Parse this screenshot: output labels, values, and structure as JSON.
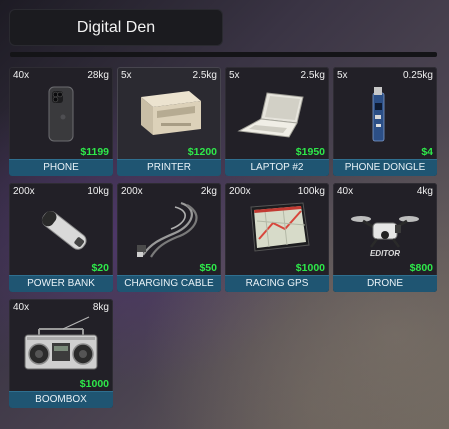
{
  "header": {
    "title": "Digital Den"
  },
  "items": [
    {
      "name": "PHONE",
      "quantity": "40x",
      "weight": "28kg",
      "price": "$1199",
      "icon": "phone-icon"
    },
    {
      "name": "PRINTER",
      "quantity": "5x",
      "weight": "2.5kg",
      "price": "$1200",
      "icon": "printer-icon"
    },
    {
      "name": "LAPTOP #2",
      "quantity": "5x",
      "weight": "2.5kg",
      "price": "$1950",
      "icon": "laptop-icon"
    },
    {
      "name": "PHONE DONGLE",
      "quantity": "5x",
      "weight": "0.25kg",
      "price": "$4",
      "icon": "phone-dongle-icon"
    },
    {
      "name": "POWER BANK",
      "quantity": "200x",
      "weight": "10kg",
      "price": "$20",
      "icon": "power-bank-icon"
    },
    {
      "name": "CHARGING CABLE",
      "quantity": "200x",
      "weight": "2kg",
      "price": "$50",
      "icon": "charging-cable-icon"
    },
    {
      "name": "RACING GPS",
      "quantity": "200x",
      "weight": "100kg",
      "price": "$1000",
      "icon": "gps-icon"
    },
    {
      "name": "DRONE",
      "quantity": "40x",
      "weight": "4kg",
      "price": "$800",
      "icon": "drone-icon",
      "image_caption": "EDITOR"
    },
    {
      "name": "BOOMBOX",
      "quantity": "40x",
      "weight": "8kg",
      "price": "$1000",
      "icon": "boombox-icon"
    }
  ]
}
